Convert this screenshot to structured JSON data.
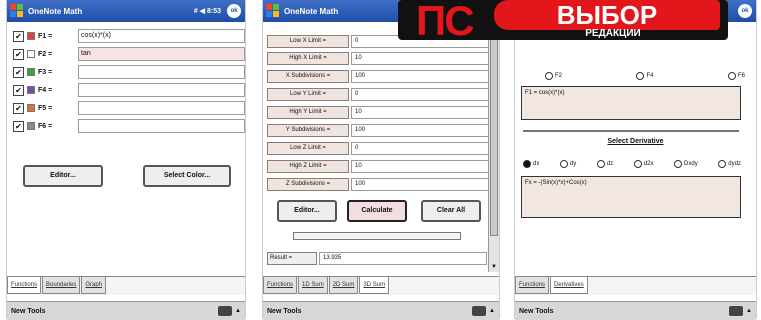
{
  "screens": [
    {
      "title": "OneNote Math",
      "tray": "# ◀ 8:53",
      "ok_label": "ok",
      "functions": [
        {
          "label": "F1 =",
          "value": "cos(x)*(x)",
          "checked": "✔",
          "color": "#e04040",
          "highlight": false
        },
        {
          "label": "F2 =",
          "value": "tan",
          "checked": "✔",
          "color": "#ffffff",
          "highlight": true
        },
        {
          "label": "F3 =",
          "value": "",
          "checked": "✔",
          "color": "#3aa13a",
          "highlight": false
        },
        {
          "label": "F4 =",
          "value": "",
          "checked": "✔",
          "color": "#7a4aa8",
          "highlight": false
        },
        {
          "label": "F5 =",
          "value": "",
          "checked": "✔",
          "color": "#e07030",
          "highlight": false
        },
        {
          "label": "F6 =",
          "value": "",
          "checked": "✔",
          "color": "#8a8a8a",
          "highlight": false
        }
      ],
      "editor_button": "Editor...",
      "select_color_button": "Select Color...",
      "tabs": [
        "Functions",
        "Boundaries",
        "Graph"
      ],
      "menu": "New Tools"
    },
    {
      "title": "OneNote Math",
      "ranges": [
        {
          "label": "Low X Limit =",
          "value": "0"
        },
        {
          "label": "High X Limit =",
          "value": "10"
        },
        {
          "label": "X Subdivisions =",
          "value": "100"
        },
        {
          "label": "Low Y Limit =",
          "value": "0"
        },
        {
          "label": "High Y Limit =",
          "value": "10"
        },
        {
          "label": "Y Subdivisions =",
          "value": "100"
        },
        {
          "label": "Low Z Limit =",
          "value": "0"
        },
        {
          "label": "High Z Limit =",
          "value": "10"
        },
        {
          "label": "Z Subdivisions =",
          "value": "100"
        }
      ],
      "editor_button": "Editor...",
      "calculate_button": "Calculate",
      "clear_all_button": "Clear All",
      "progress": 0,
      "result_label": "Result =",
      "result_value": "13.935",
      "tabs": [
        "Functions",
        "1D Sum",
        "2D Sum",
        "3D Sum"
      ],
      "menu": "New Tools"
    },
    {
      "top_radios": [
        "F2",
        "F4",
        "F6"
      ],
      "function_box": "F1 = cos(x)*(x)",
      "derivative_heading": "Select Derivative",
      "derivative_options": [
        "dx",
        "dy",
        "dz",
        "d2x",
        "Dxdy",
        "dydz"
      ],
      "derivative_box": "Fx = -(Sin(x)*x)+Cos(x)",
      "tabs": [
        "Functions",
        "Derivatives"
      ],
      "menu": "New Tools"
    }
  ],
  "badge": {
    "brand": "ПС",
    "word": "ВЫБОР",
    "subword": "РЕДАКЦИИ"
  }
}
